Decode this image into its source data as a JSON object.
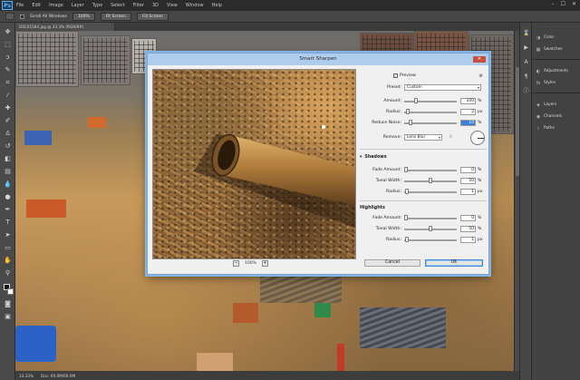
{
  "app": {
    "logo": "Ps"
  },
  "menu": [
    "File",
    "Edit",
    "Image",
    "Layer",
    "Type",
    "Select",
    "Filter",
    "3D",
    "View",
    "Window",
    "Help"
  ],
  "window_controls": [
    "–",
    "☐",
    "✕"
  ],
  "options": {
    "scroll_all": "Scroll All Windows",
    "btn1": "100%",
    "btn2": "Fit Screen",
    "btn3": "Fill Screen"
  },
  "document_tab": "DSC01584.jpg @ 33.3% (RGB/8#)",
  "status": {
    "zoom": "33.33%",
    "doc": "Doc: 69.0M/69.0M"
  },
  "panels": [
    {
      "label": "Color",
      "icon": "color-icon"
    },
    {
      "label": "Swatches",
      "icon": "swatches-icon"
    },
    {
      "label": "Adjustments",
      "icon": "adjustments-icon"
    },
    {
      "label": "Styles",
      "icon": "styles-icon"
    },
    {
      "label": "Layers",
      "icon": "layers-icon"
    },
    {
      "label": "Channels",
      "icon": "channels-icon"
    },
    {
      "label": "Paths",
      "icon": "paths-icon"
    }
  ],
  "dialog": {
    "title": "Smart Sharpen",
    "preview_label": "Preview",
    "preview_checked": true,
    "zoom": "100%",
    "preset_label": "Preset:",
    "preset_value": "Custom",
    "amount": {
      "label": "Amount:",
      "value": "100",
      "unit": "%",
      "level": 0.2
    },
    "radius": {
      "label": "Radius:",
      "value": "2",
      "unit": "px",
      "level": 0.03
    },
    "reduce_noise": {
      "label": "Reduce Noise:",
      "value": "10",
      "unit": "%",
      "level": 0.1
    },
    "remove_label": "Remove:",
    "remove_value": "Lens Blur",
    "angle_value": "0",
    "shadows": {
      "title": "Shadows",
      "fade": {
        "label": "Fade Amount:",
        "value": "0",
        "unit": "%",
        "level": 0.0
      },
      "tonal": {
        "label": "Tonal Width:",
        "value": "50",
        "unit": "%",
        "level": 0.5
      },
      "radius": {
        "label": "Radius:",
        "value": "1",
        "unit": "px",
        "level": 0.01
      }
    },
    "highlights": {
      "title": "Highlights",
      "fade": {
        "label": "Fade Amount:",
        "value": "0",
        "unit": "%",
        "level": 0.0
      },
      "tonal": {
        "label": "Tonal Width:",
        "value": "50",
        "unit": "%",
        "level": 0.5
      },
      "radius": {
        "label": "Radius:",
        "value": "1",
        "unit": "px",
        "level": 0.01
      }
    },
    "cancel_label": "Cancel",
    "ok_label": "OK"
  }
}
